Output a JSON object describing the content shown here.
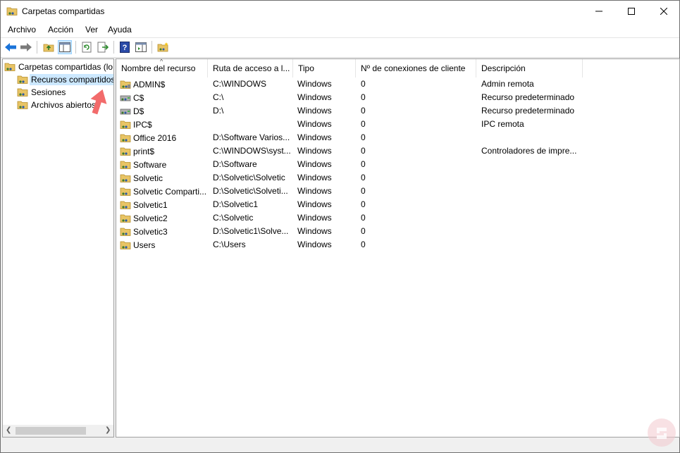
{
  "window": {
    "title": "Carpetas compartidas"
  },
  "menu": [
    "Archivo",
    "Acción",
    "Ver",
    "Ayuda"
  ],
  "tree": {
    "root": "Carpetas compartidas (lo",
    "items": [
      "Recursos compartidos",
      "Sesiones",
      "Archivos abiertos"
    ]
  },
  "columns": [
    "Nombre del recurso",
    "Ruta de acceso a l...",
    "Tipo",
    "Nº de conexiones de cliente",
    "Descripción"
  ],
  "rows": [
    {
      "name": "ADMIN$",
      "path": "C:\\WINDOWS",
      "type": "Windows",
      "conn": "0",
      "desc": "Admin remota",
      "icon": "admin-share-icon"
    },
    {
      "name": "C$",
      "path": "C:\\",
      "type": "Windows",
      "conn": "0",
      "desc": "Recurso predeterminado",
      "icon": "drive-share-icon"
    },
    {
      "name": "D$",
      "path": "D:\\",
      "type": "Windows",
      "conn": "0",
      "desc": "Recurso predeterminado",
      "icon": "drive-share-icon"
    },
    {
      "name": "IPC$",
      "path": "",
      "type": "Windows",
      "conn": "0",
      "desc": "IPC remota",
      "icon": "ipc-share-icon"
    },
    {
      "name": "Office 2016",
      "path": "D:\\Software Varios...",
      "type": "Windows",
      "conn": "0",
      "desc": "",
      "icon": "shared-folder-icon"
    },
    {
      "name": "print$",
      "path": "C:\\WINDOWS\\syst...",
      "type": "Windows",
      "conn": "0",
      "desc": "Controladores de impre...",
      "icon": "shared-folder-icon"
    },
    {
      "name": "Software",
      "path": "D:\\Software",
      "type": "Windows",
      "conn": "0",
      "desc": "",
      "icon": "shared-folder-icon"
    },
    {
      "name": "Solvetic",
      "path": "D:\\Solvetic\\Solvetic",
      "type": "Windows",
      "conn": "0",
      "desc": "",
      "icon": "shared-folder-icon"
    },
    {
      "name": "Solvetic Comparti...",
      "path": "D:\\Solvetic\\Solveti...",
      "type": "Windows",
      "conn": "0",
      "desc": "",
      "icon": "shared-folder-icon"
    },
    {
      "name": "Solvetic1",
      "path": "D:\\Solvetic1",
      "type": "Windows",
      "conn": "0",
      "desc": "",
      "icon": "shared-folder-icon"
    },
    {
      "name": "Solvetic2",
      "path": "C:\\Solvetic",
      "type": "Windows",
      "conn": "0",
      "desc": "",
      "icon": "shared-folder-icon"
    },
    {
      "name": "Solvetic3",
      "path": "D:\\Solvetic1\\Solve...",
      "type": "Windows",
      "conn": "0",
      "desc": "",
      "icon": "shared-folder-icon"
    },
    {
      "name": "Users",
      "path": "C:\\Users",
      "type": "Windows",
      "conn": "0",
      "desc": "",
      "icon": "shared-folder-icon"
    }
  ],
  "colors": {
    "selection": "#cce8ff",
    "accent_arrow": "#f26b6b",
    "toolbar_blue": "#1a73d9"
  }
}
